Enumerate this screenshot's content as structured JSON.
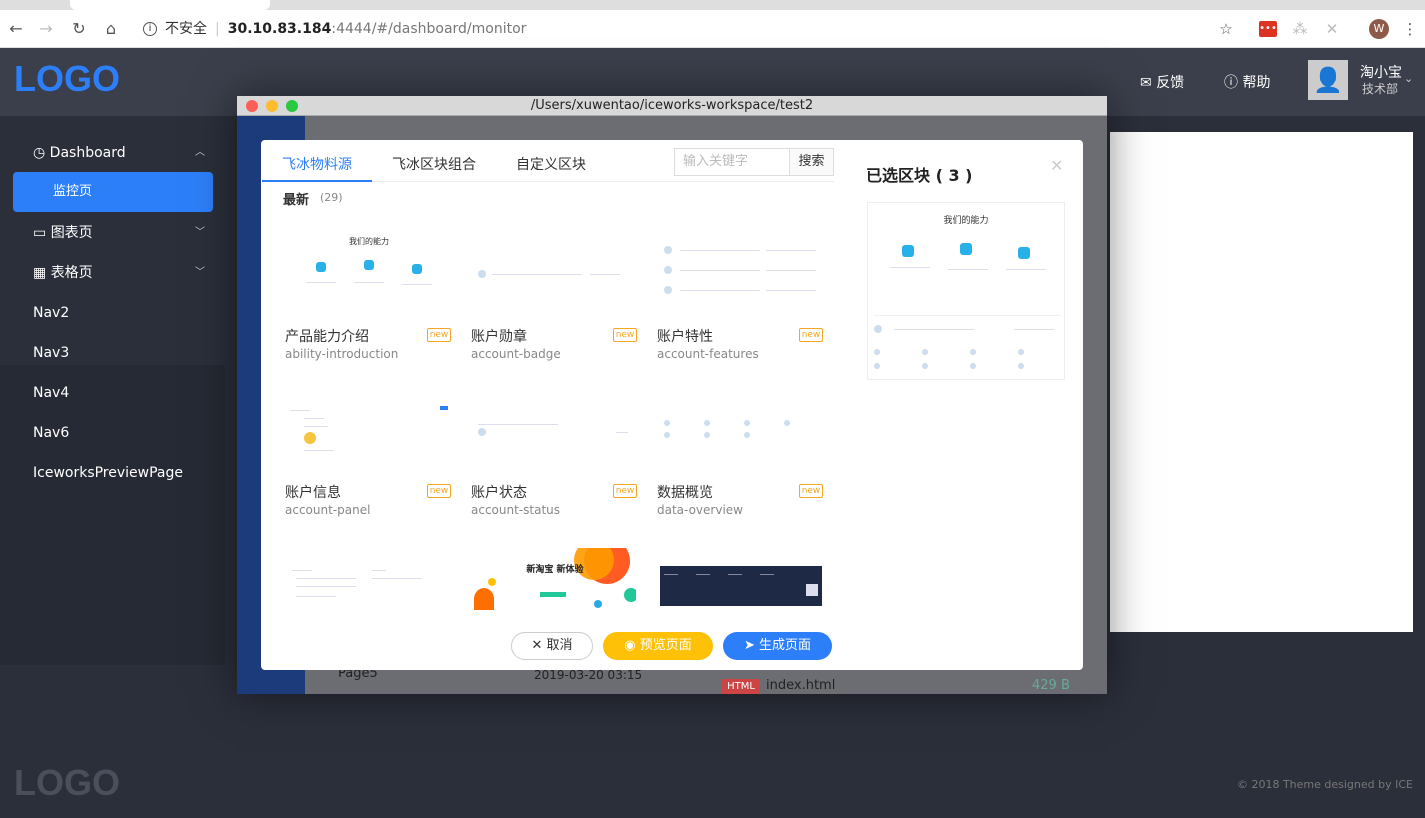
{
  "browser": {
    "insecure_label": "不安全",
    "url_host": "30.10.83.184",
    "url_path": ":4444/#/dashboard/monitor",
    "avatar_letter": "W"
  },
  "header": {
    "logo": "LOGO",
    "feedback": "反馈",
    "help": "帮助",
    "user_name": "淘小宝",
    "user_dept": "技术部"
  },
  "sidebar": {
    "items": [
      {
        "label": "Dashboard"
      },
      {
        "label": "监控页"
      },
      {
        "label": "图表页"
      },
      {
        "label": "表格页"
      },
      {
        "label": "Nav2"
      },
      {
        "label": "Nav3"
      },
      {
        "label": "Nav4"
      },
      {
        "label": "Nav6"
      },
      {
        "label": "IceworksPreviewPage"
      }
    ]
  },
  "footer": {
    "logo": "LOGO",
    "copyright": "© 2018 Theme designed by ICE"
  },
  "mac_window": {
    "title": "/Users/xuwentao/iceworks-workspace/test2"
  },
  "behind": {
    "page5": "Page5",
    "date": "2019-03-20 03:15",
    "html_tag": "HTML",
    "file": "index.html",
    "size": "429 B"
  },
  "modal": {
    "tabs": [
      "飞冰物料源",
      "飞冰区块组合",
      "自定义区块"
    ],
    "search_placeholder": "输入关键字",
    "search_button": "搜索",
    "section_title": "最新",
    "section_count": "(29)",
    "badge": "new",
    "cards": [
      {
        "title": "产品能力介绍",
        "sub": "ability-introduction",
        "thumb_text": "我们的能力"
      },
      {
        "title": "账户勋章",
        "sub": "account-badge"
      },
      {
        "title": "账户特性",
        "sub": "account-features"
      },
      {
        "title": "账户信息",
        "sub": "account-panel"
      },
      {
        "title": "账户状态",
        "sub": "account-status"
      },
      {
        "title": "数据概览",
        "sub": "data-overview"
      },
      {
        "title": "",
        "sub": ""
      },
      {
        "title": "",
        "sub": "",
        "thumb_text": "新淘宝 新体验"
      },
      {
        "title": "",
        "sub": ""
      }
    ],
    "buttons": {
      "cancel": "取消",
      "preview": "预览页面",
      "generate": "生成页面"
    },
    "selected": {
      "title": "已选区块 ( 3 )",
      "preview_text": "我们的能力"
    }
  }
}
